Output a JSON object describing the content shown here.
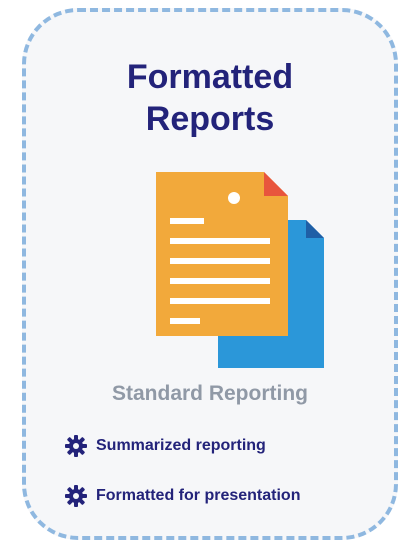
{
  "card": {
    "title_line1": "Formatted",
    "title_line2": "Reports",
    "illustration_icon": "document-stack-icon",
    "subtitle": "Standard Reporting",
    "features": [
      {
        "label": "Summarized reporting",
        "icon": "gear-icon"
      },
      {
        "label": "Formatted for presentation",
        "icon": "gear-icon"
      }
    ]
  },
  "colors": {
    "title": "#23237a",
    "subtitle": "#9099a6",
    "border": "#8fb8e0",
    "doc_front": "#f2a93b",
    "doc_back": "#2b97d9",
    "doc_corner_front": "#e8553d",
    "doc_corner_back": "#1f5fa6"
  }
}
